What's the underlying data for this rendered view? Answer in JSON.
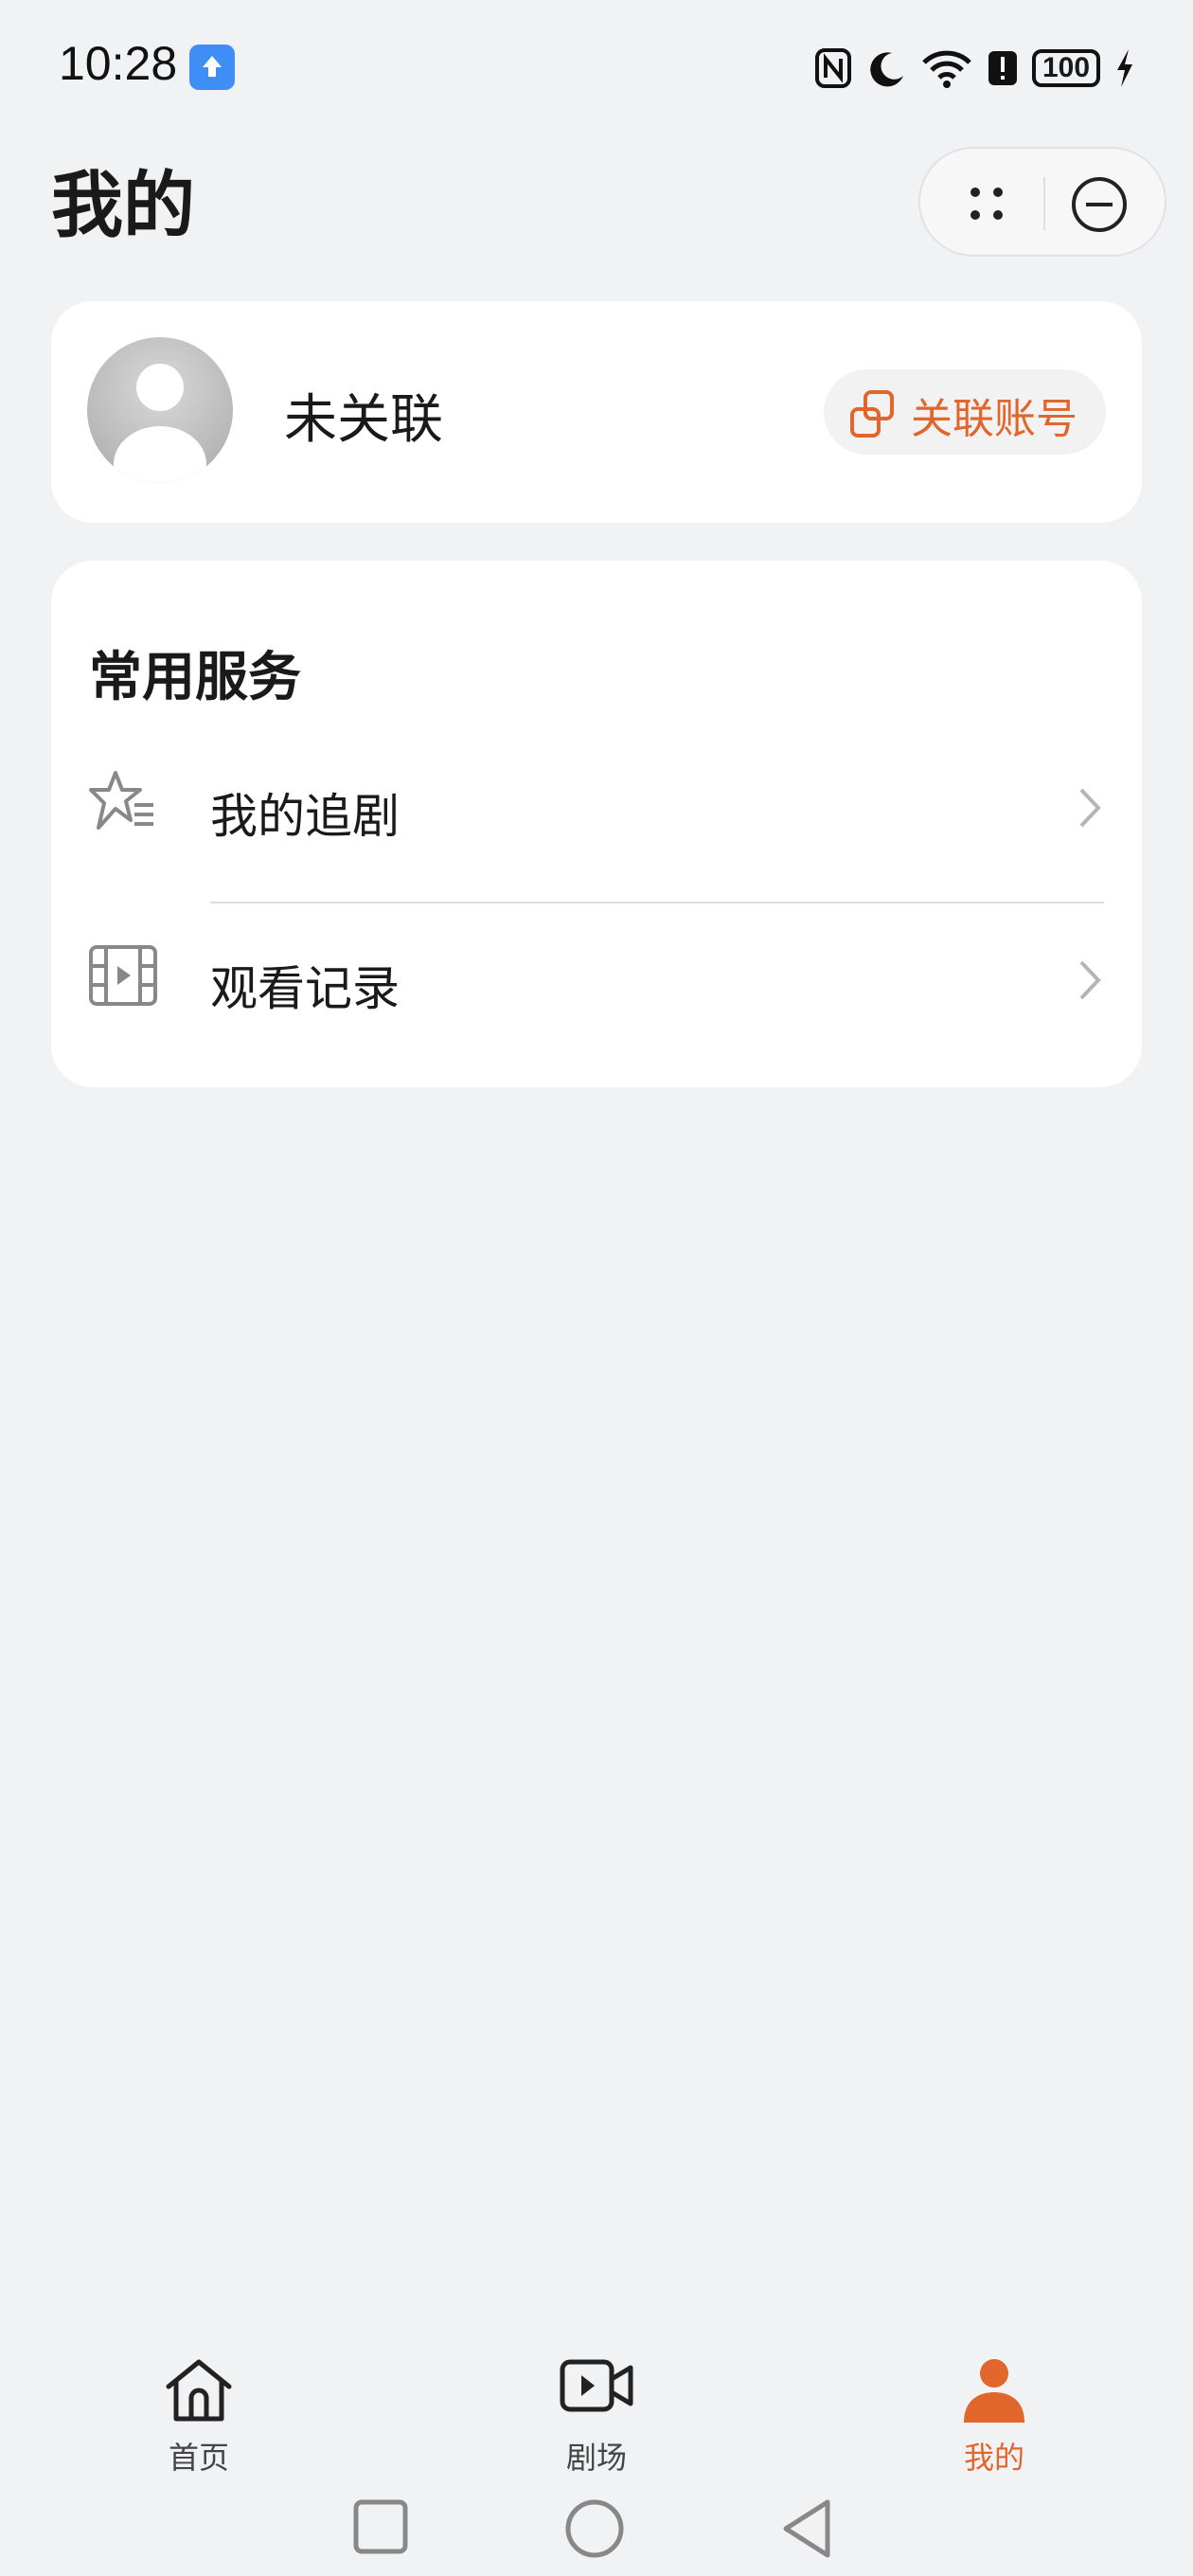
{
  "status_bar": {
    "time": "10:28",
    "battery": "100"
  },
  "header": {
    "title": "我的"
  },
  "account": {
    "name": "未关联",
    "link_button": "关联账号"
  },
  "services": {
    "title": "常用服务",
    "items": [
      {
        "label": "我的追剧",
        "icon": "star-list-icon"
      },
      {
        "label": "观看记录",
        "icon": "film-play-icon"
      }
    ]
  },
  "bottom_nav": {
    "items": [
      {
        "label": "首页",
        "icon": "home-icon"
      },
      {
        "label": "剧场",
        "icon": "video-camera-icon"
      },
      {
        "label": "我的",
        "icon": "person-icon",
        "active": true
      }
    ]
  },
  "colors": {
    "accent": "#e0662b",
    "background": "#f1f2f4"
  }
}
